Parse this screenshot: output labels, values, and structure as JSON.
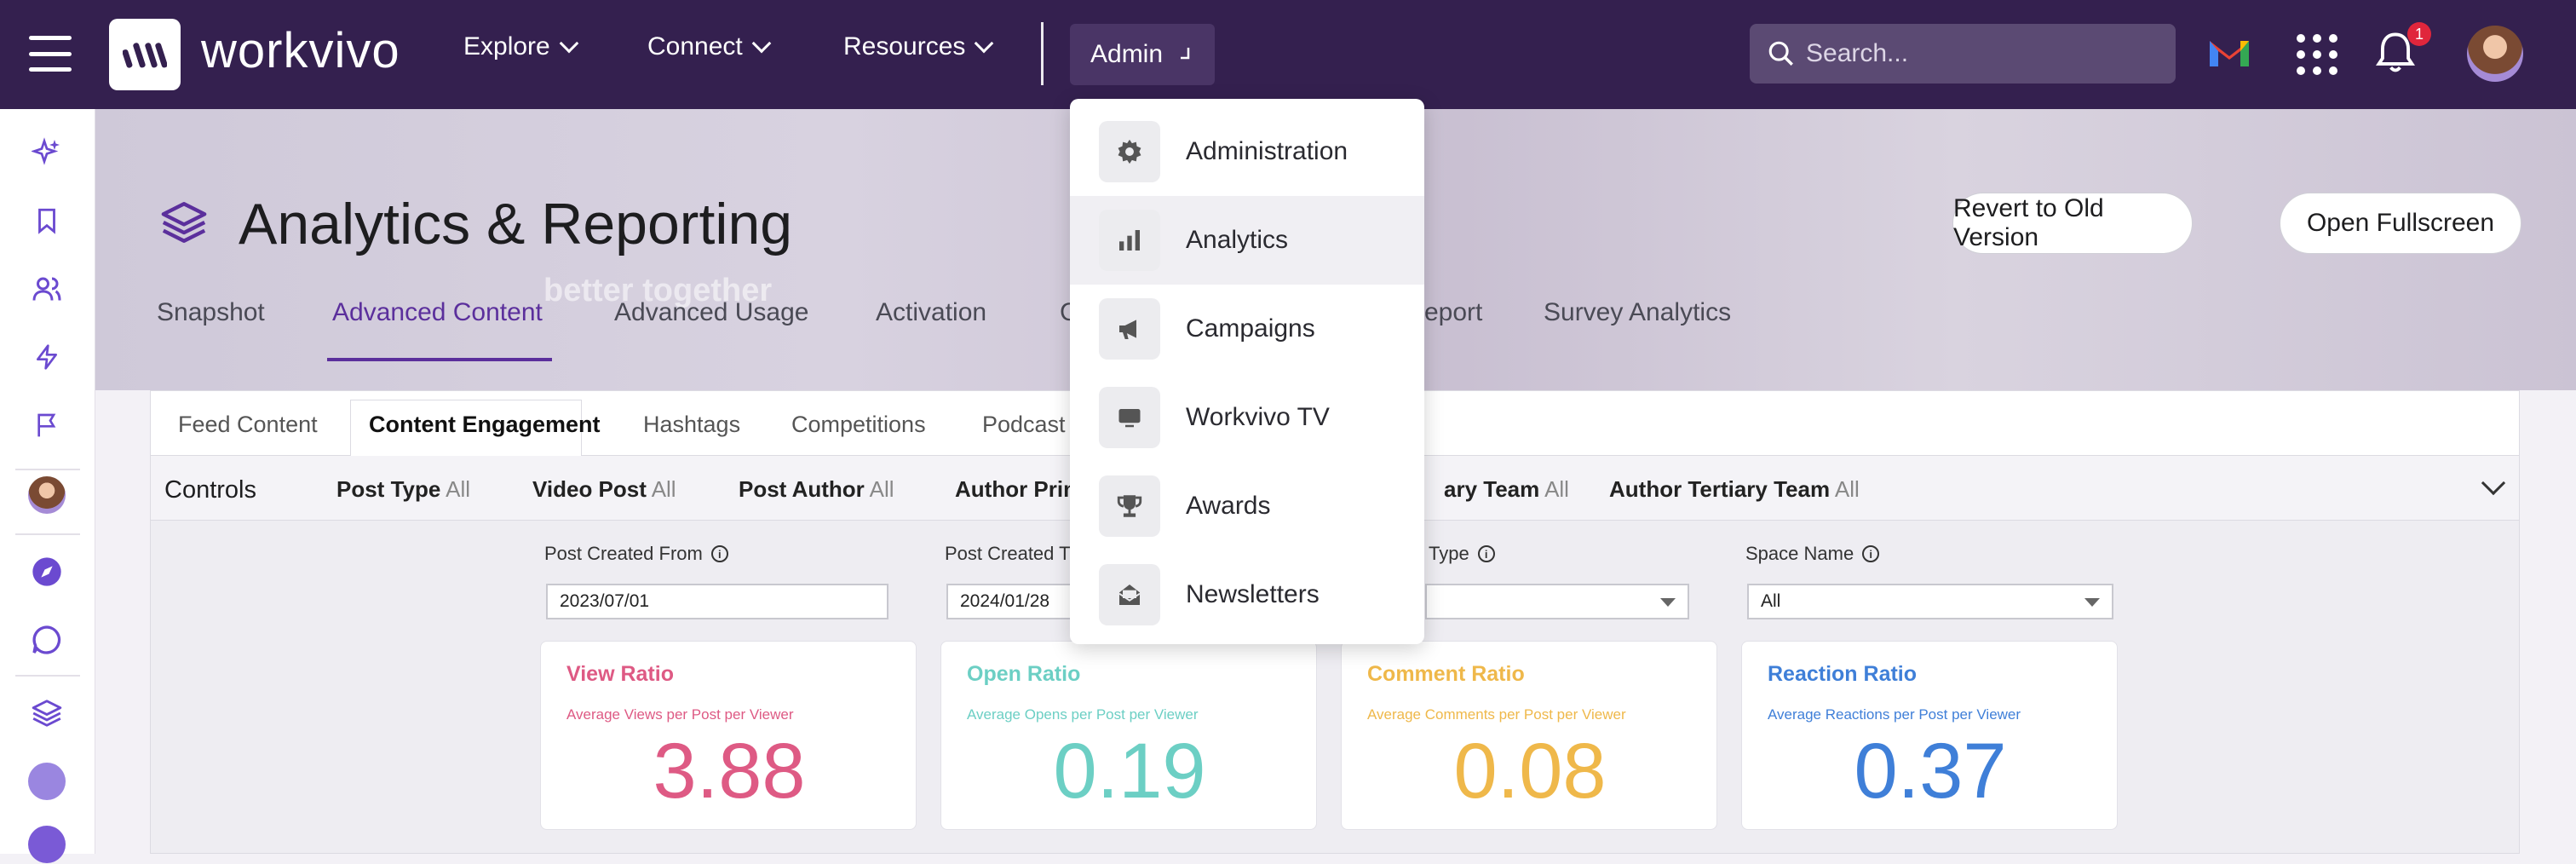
{
  "brand": {
    "name": "workvivo"
  },
  "topnav": {
    "items": [
      {
        "label": "Explore"
      },
      {
        "label": "Connect"
      },
      {
        "label": "Resources"
      }
    ],
    "admin_label": "Admin",
    "search_placeholder": "Search...",
    "notifications_count": "1"
  },
  "admin_menu": {
    "items": [
      {
        "label": "Administration",
        "icon": "gear-icon"
      },
      {
        "label": "Analytics",
        "icon": "bar-chart-icon",
        "highlighted": true
      },
      {
        "label": "Campaigns",
        "icon": "megaphone-icon"
      },
      {
        "label": "Workvivo TV",
        "icon": "tv-icon"
      },
      {
        "label": "Awards",
        "icon": "trophy-icon"
      },
      {
        "label": "Newsletters",
        "icon": "newsletter-icon"
      }
    ]
  },
  "hero": {
    "ghost_text": "better together"
  },
  "page": {
    "title": "Analytics & Reporting",
    "revert_label": "Revert to Old Version",
    "fullscreen_label": "Open Fullscreen"
  },
  "tabs": [
    {
      "label": "Snapshot"
    },
    {
      "label": "Advanced Content",
      "active": true
    },
    {
      "label": "Advanced Usage"
    },
    {
      "label": "Activation"
    },
    {
      "label": "C"
    },
    {
      "label": "eport"
    },
    {
      "label": "Survey Analytics"
    }
  ],
  "subtabs": [
    {
      "label": "Feed Content"
    },
    {
      "label": "Content Engagement",
      "active": true
    },
    {
      "label": "Hashtags"
    },
    {
      "label": "Competitions"
    },
    {
      "label": "Podcast"
    }
  ],
  "controls": {
    "label": "Controls",
    "items": [
      {
        "name": "Post Type",
        "value": "All"
      },
      {
        "name": "Video Post",
        "value": "All"
      },
      {
        "name": "Post Author",
        "value": "All"
      },
      {
        "name": "Author Prim",
        "value": ""
      },
      {
        "name": "ary Team",
        "value": "All"
      },
      {
        "name": "Author Tertiary Team",
        "value": "All"
      }
    ]
  },
  "filters": {
    "created_from_label": "Post Created From",
    "created_from_value": "2023/07/01",
    "created_to_label": "Post Created T",
    "created_to_value": "2024/01/28",
    "type_label": "Type",
    "space_label": "Space Name",
    "space_value": "All"
  },
  "cards": [
    {
      "title": "View Ratio",
      "subtitle": "Average Views per Post per Viewer",
      "value": "3.88",
      "color": "#de5a84"
    },
    {
      "title": "Open Ratio",
      "subtitle": "Average Opens per Post per Viewer",
      "value": "0.19",
      "color": "#6ccfc4"
    },
    {
      "title": "Comment Ratio",
      "subtitle": "Average Comments per Post per Viewer",
      "value": "0.08",
      "color": "#efb84a"
    },
    {
      "title": "Reaction Ratio",
      "subtitle": "Average Reactions per Post per Viewer",
      "value": "0.37",
      "color": "#3f7fd8"
    }
  ],
  "colors": {
    "topbar": "#34204f",
    "accent": "#5b2f9c"
  }
}
